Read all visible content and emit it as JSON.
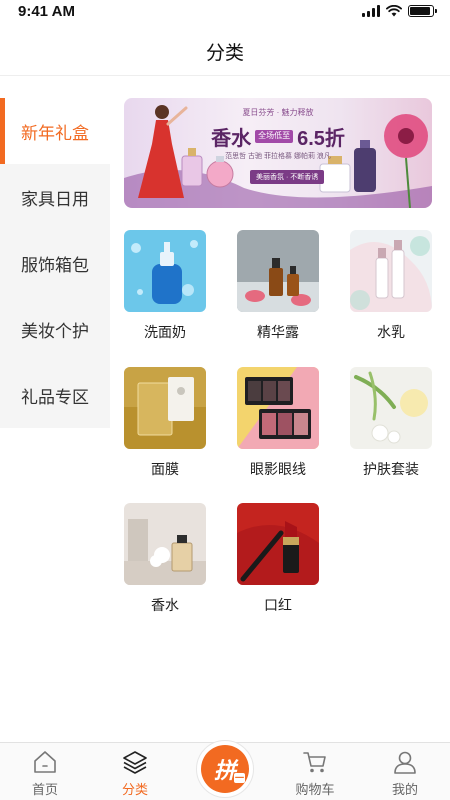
{
  "status_bar": {
    "time": "9:41 AM",
    "battery_level": 0.9
  },
  "header": {
    "title": "分类"
  },
  "sidebar": {
    "items": [
      {
        "label": "新年礼盒",
        "active": true
      },
      {
        "label": "家具日用",
        "active": false
      },
      {
        "label": "服饰箱包",
        "active": false
      },
      {
        "label": "美妆个护",
        "active": false
      },
      {
        "label": "礼品专区",
        "active": false
      }
    ]
  },
  "banner": {
    "tagline": "夏日芬芳 · 魅力释放",
    "title": "香水",
    "badge": "全场低至",
    "discount": "6.5折",
    "brands": "范思哲  古驰  菲拉格慕  娜帕莉  浪凡",
    "button": "美丽香氛 · 不断香诱"
  },
  "products": [
    {
      "name": "洗面奶",
      "image": "cleanser-bottle"
    },
    {
      "name": "精华露",
      "image": "essence-droppers"
    },
    {
      "name": "水乳",
      "image": "lotion-bottles"
    },
    {
      "name": "面膜",
      "image": "facial-mask"
    },
    {
      "name": "眼影眼线",
      "image": "eyeshadow-palette"
    },
    {
      "name": "护肤套装",
      "image": "skincare-set"
    },
    {
      "name": "香水",
      "image": "perfume-bottle"
    },
    {
      "name": "口红",
      "image": "lipstick"
    }
  ],
  "bottom_nav": {
    "items": [
      {
        "label": "首页",
        "icon": "home-icon",
        "active": false
      },
      {
        "label": "分类",
        "icon": "category-icon",
        "active": true
      },
      {
        "label": "购物车",
        "icon": "cart-icon",
        "active": false
      },
      {
        "label": "我的",
        "icon": "user-icon",
        "active": false
      }
    ],
    "center_button": {
      "label": "拼",
      "sub": "一"
    }
  },
  "colors": {
    "accent": "#f26a21",
    "sidebar_bg": "#f5f5f5",
    "text": "#222222"
  }
}
